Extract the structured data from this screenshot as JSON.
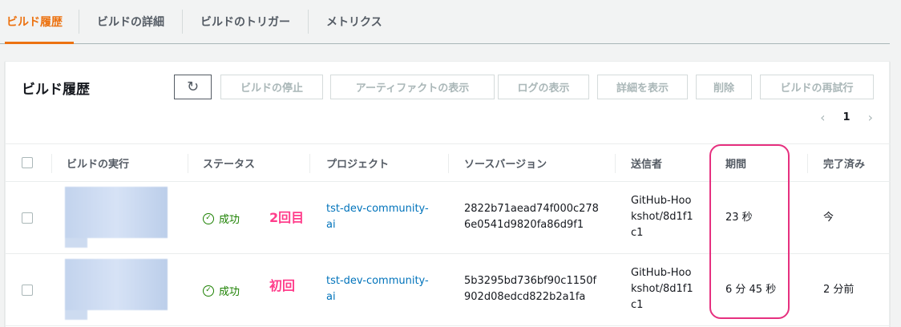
{
  "tabs": [
    "ビルド履歴",
    "ビルドの詳細",
    "ビルドのトリガー",
    "メトリクス"
  ],
  "panel": {
    "title": "ビルド履歴",
    "buttons": {
      "stop": "ビルドの停止",
      "artifacts": "アーティファクトの表示",
      "logs": "ログの表示",
      "details": "詳細を表示",
      "delete": "削除",
      "retry": "ビルドの再試行"
    },
    "page_number": "1"
  },
  "table": {
    "columns": [
      "ビルドの実行",
      "ステータス",
      "プロジェクト",
      "ソースバージョン",
      "送信者",
      "期間",
      "完了済み"
    ],
    "rows": [
      {
        "status": "成功",
        "annotation": "2回目",
        "project": [
          "tst-dev-community-",
          "ai"
        ],
        "source_version": [
          "2822b71aead74f000c278",
          "6e0541d9820fa86d9f1"
        ],
        "sender": [
          "GitHub-Hoo",
          "kshot/8d1f1",
          "c1"
        ],
        "duration": "23 秒",
        "completed": "今"
      },
      {
        "status": "成功",
        "annotation": "初回",
        "project": [
          "tst-dev-community-",
          "ai"
        ],
        "source_version": [
          "5b3295bd736bf90c1150f",
          "902d08edcd822b2a1fa"
        ],
        "sender": [
          "GitHub-Hoo",
          "kshot/8d1f1",
          "c1"
        ],
        "duration": "6 分 45 秒",
        "completed": "2 分前"
      }
    ]
  },
  "colors": {
    "accent": "#ec7211",
    "success": "#1d8102",
    "link": "#0073bb",
    "annotation": "#ff3d8b"
  }
}
